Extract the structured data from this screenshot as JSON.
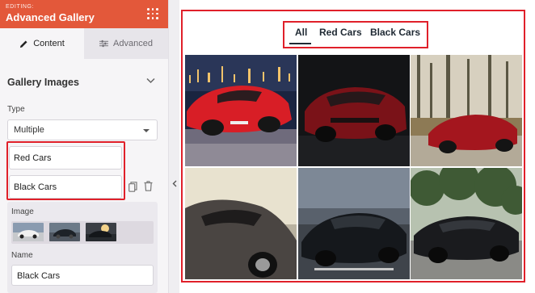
{
  "panel": {
    "editing_label": "EDITING:",
    "title": "Advanced Gallery",
    "tabs": [
      {
        "label": "Content",
        "active": true
      },
      {
        "label": "Advanced",
        "active": false
      }
    ],
    "section_title": "Gallery Images",
    "type_label": "Type",
    "type_value": "Multiple",
    "gallery_items": [
      {
        "label": "Red Cars"
      },
      {
        "label": "Black Cars"
      }
    ],
    "image_label": "Image",
    "name_label": "Name",
    "name_value": "Black Cars"
  },
  "preview": {
    "filters": [
      {
        "label": "All",
        "active": true
      },
      {
        "label": "Red Cars",
        "active": false
      },
      {
        "label": "Black Cars",
        "active": false
      }
    ],
    "photos": [
      {
        "name": "red-sports-car-city-night"
      },
      {
        "name": "red-sports-car-dark-studio"
      },
      {
        "name": "red-coupe-forest-road"
      },
      {
        "name": "dark-sports-car-desert"
      },
      {
        "name": "black-sedan-city-road"
      },
      {
        "name": "black-muscle-car-park"
      }
    ]
  },
  "colors": {
    "accent": "#e3583a",
    "highlight": "#e0202a",
    "panel_bg": "#f6f5f7",
    "text_dark": "#1f2933"
  }
}
